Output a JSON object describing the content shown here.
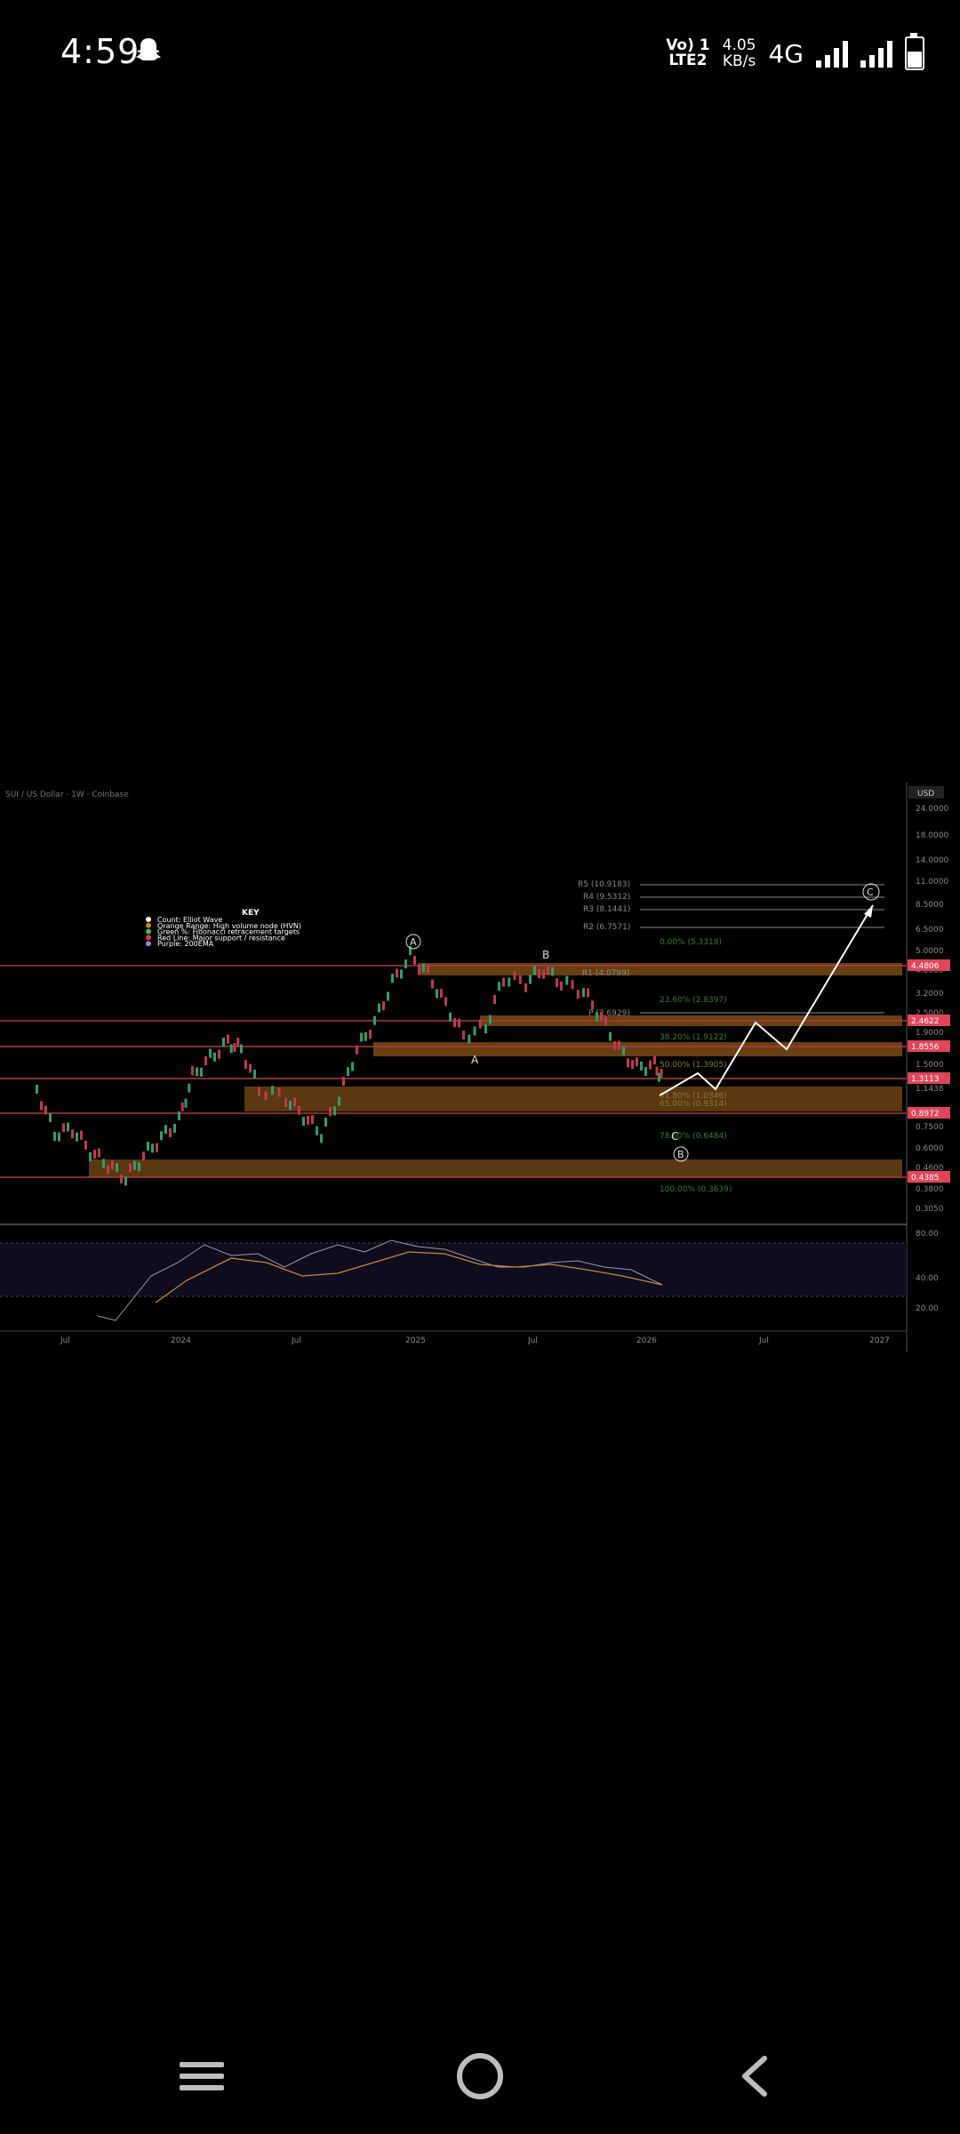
{
  "status": {
    "time": "4:59",
    "volte_top": "Vo) 1",
    "volte_bottom": "LTE2",
    "speed_value": "4.05",
    "speed_unit": "KB/s",
    "network": "4G",
    "icons": [
      "snapchat-ghost-icon",
      "signal-bars-icon",
      "signal-bars-icon",
      "battery-icon"
    ]
  },
  "chart": {
    "title": "SUI / US Dollar · 1W · Coinbase",
    "currency": "USD",
    "key_title": "KEY",
    "key_items": [
      {
        "label": "Count: Elliot Wave",
        "color": "#ffffff"
      },
      {
        "label": "Orange Range: High volume node (HVN)",
        "color": "#c97c2a"
      },
      {
        "label": "Green %: Fibonacci retracement targets",
        "color": "#4caf50"
      },
      {
        "label": "Red Line: Major support / resistance",
        "color": "#e53935"
      },
      {
        "label": "Purple: 200EMA",
        "color": "#9c7bd6"
      }
    ],
    "price_scale": [
      "24.0000",
      "18.0000",
      "14.0000",
      "11.0000",
      "8.5000",
      "6.5000",
      "5.0000",
      "4.0000",
      "3.2000",
      "2.5000",
      "1.9000",
      "1.5000",
      "1.1438",
      "0.7500",
      "0.6000",
      "0.4600",
      "0.3800",
      "0.3050"
    ],
    "highlighted_prices": [
      {
        "value": "4.4806",
        "color": "#e0455a"
      },
      {
        "value": "2.4622",
        "color": "#e0455a"
      },
      {
        "value": "1.8556",
        "color": "#e0455a"
      },
      {
        "value": "1.3113",
        "color": "#e0455a"
      },
      {
        "value": "0.8972",
        "color": "#e0455a"
      },
      {
        "value": "0.4385",
        "color": "#e0455a"
      }
    ],
    "pivots": [
      "R5 (10.9183)",
      "R4 (9.5312)",
      "R3 (8.1441)",
      "R2 (6.7571)",
      "R1 (4.0799)",
      "P (2.6929)"
    ],
    "fibs": [
      "0.00% (5.3318)",
      "23.60% (2.8397)",
      "38.20% (1.9122)",
      "50.00% (1.3905)",
      "61.80% (1.0346)",
      "65.00% (0.9314)",
      "78.60% (0.6484)",
      "100.00% (0.3639)"
    ],
    "wave_labels": [
      "A",
      "B",
      "A",
      "C",
      "B",
      "C"
    ],
    "rsi_scale": [
      "80.00",
      "40.00",
      "20.00"
    ],
    "time_axis": [
      "Jul",
      "2024",
      "Jul",
      "2025",
      "Jul",
      "2026",
      "Jul",
      "2027"
    ]
  },
  "nav": {
    "icons": [
      "menu-icon",
      "home-icon",
      "back-icon"
    ]
  }
}
